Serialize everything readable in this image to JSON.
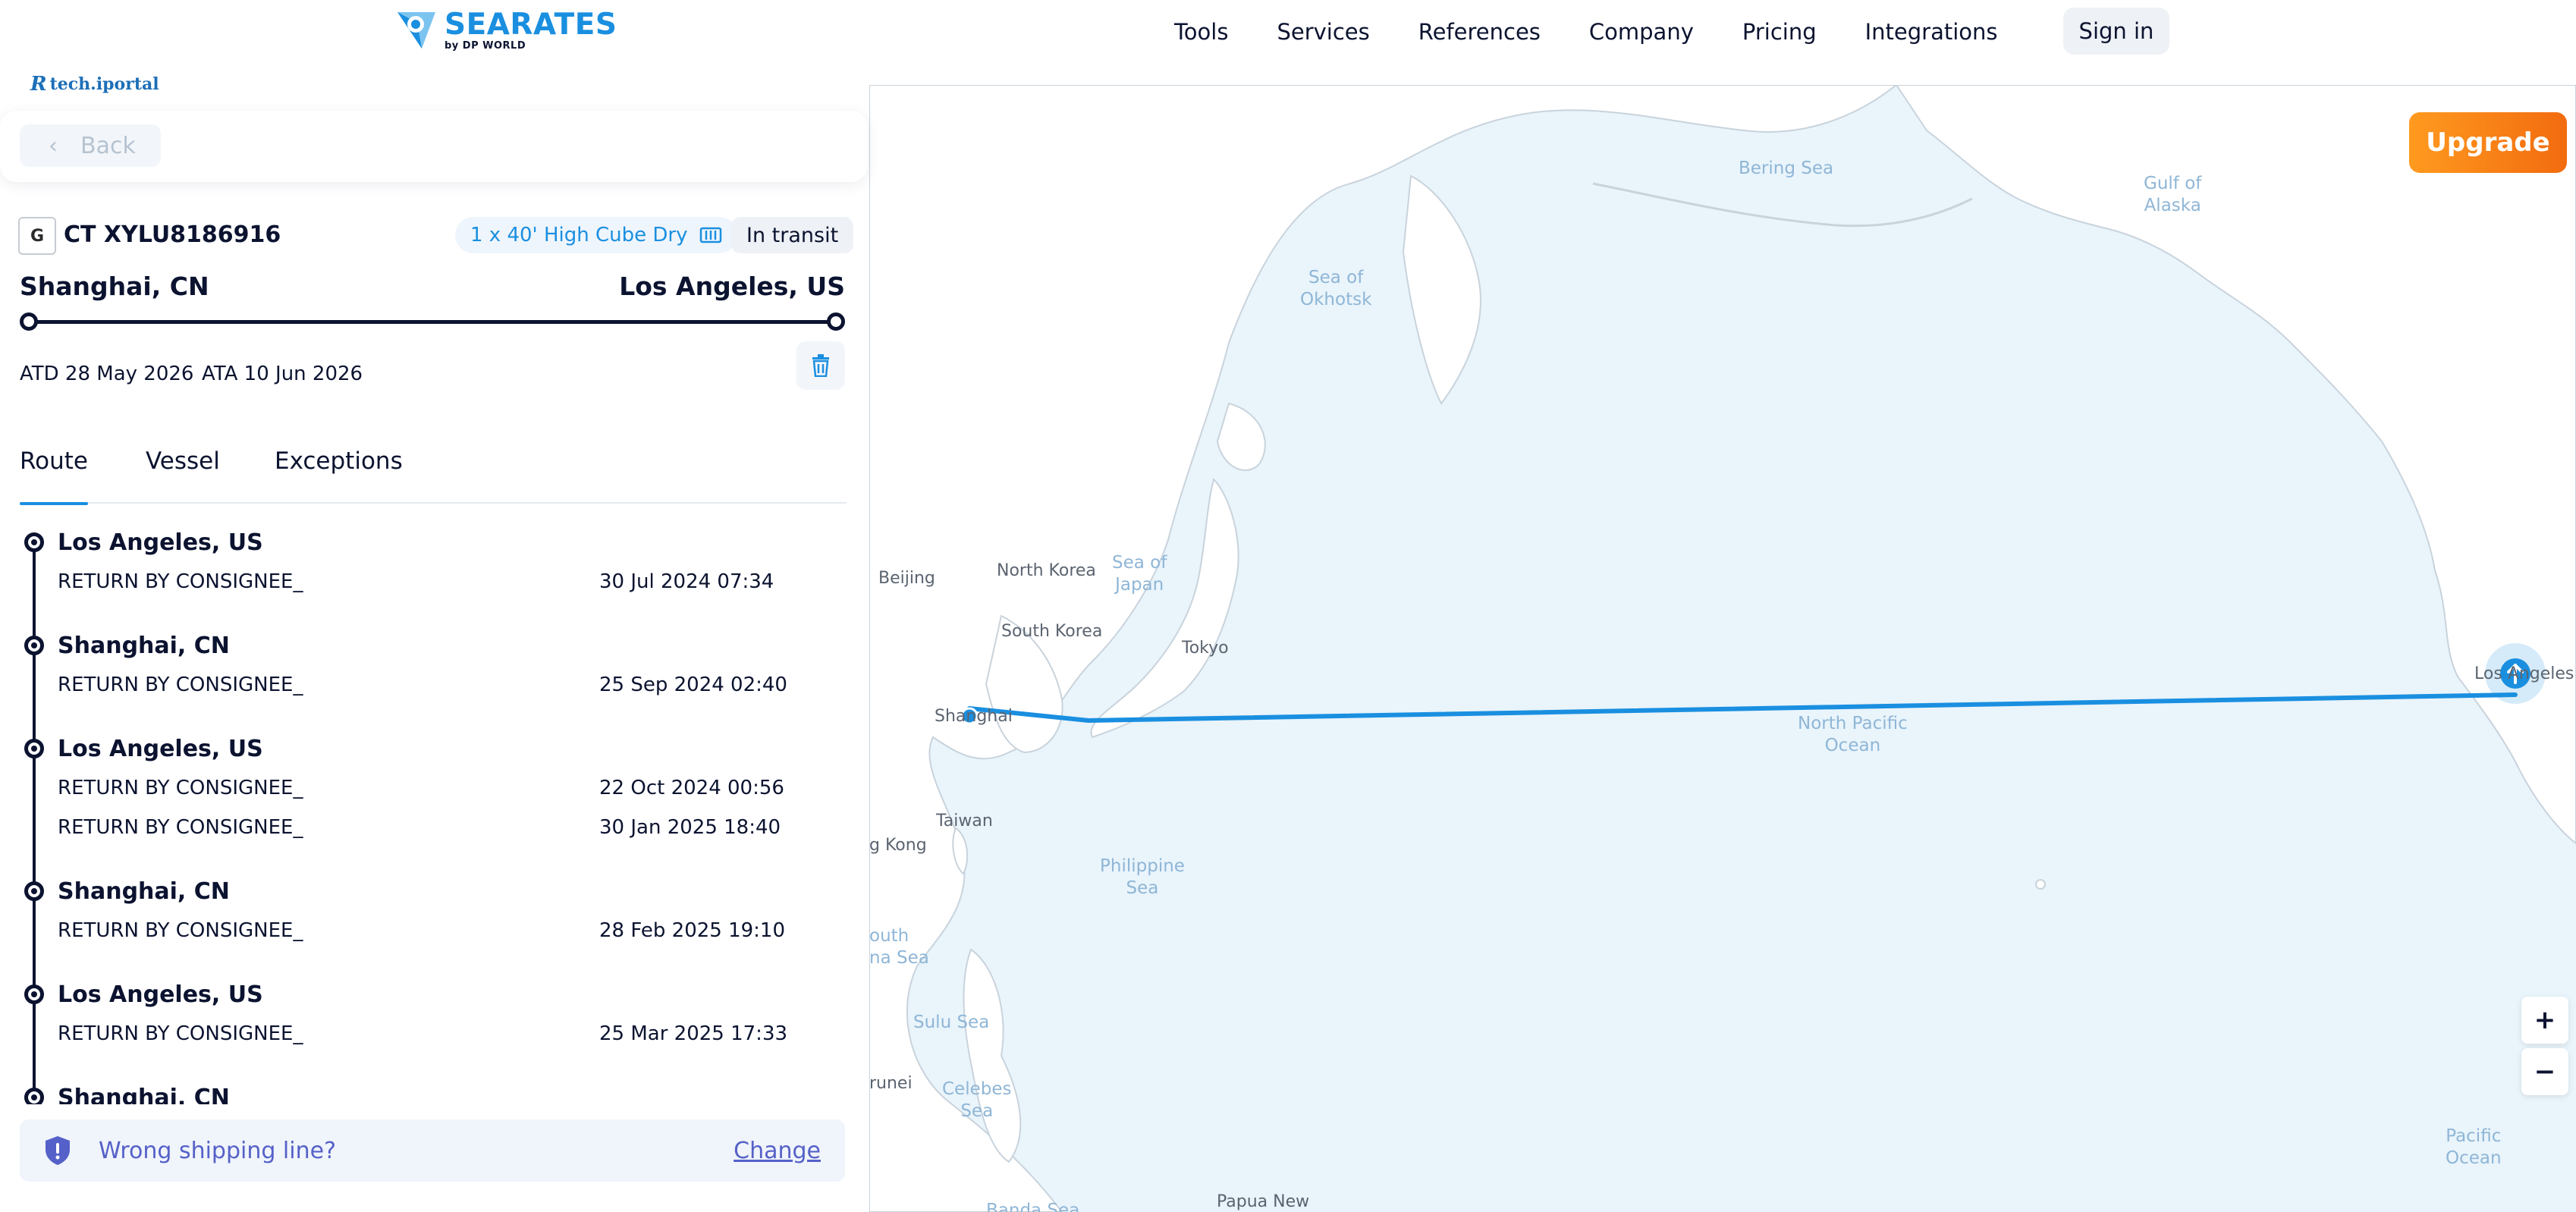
{
  "header": {
    "brand_primary": "SEARATES",
    "brand_secondary": "by DP WORLD",
    "nav": [
      "Tools",
      "Services",
      "References",
      "Company",
      "Pricing",
      "Integrations"
    ],
    "sign_in": "Sign in"
  },
  "watermark": "tech.iportal",
  "back": {
    "label": "Back"
  },
  "shipment": {
    "carrier_logo_text": "G",
    "container_id": "CT XYLU8186916",
    "container_type": "1 x 40' High Cube Dry",
    "status": "In transit",
    "origin": "Shanghai, CN",
    "destination": "Los Angeles, US",
    "atd": "ATD 28 May 2026",
    "ata": "ATA 10 Jun 2026"
  },
  "tabs": [
    "Route",
    "Vessel",
    "Exceptions"
  ],
  "events": [
    {
      "location": "Los Angeles, US",
      "items": [
        {
          "desc": "RETURN BY CONSIGNEE_",
          "time": "30 Jul 2024 07:34"
        }
      ]
    },
    {
      "location": "Shanghai, CN",
      "items": [
        {
          "desc": "RETURN BY CONSIGNEE_",
          "time": "25 Sep 2024 02:40"
        }
      ]
    },
    {
      "location": "Los Angeles, US",
      "items": [
        {
          "desc": "RETURN BY CONSIGNEE_",
          "time": "22 Oct 2024 00:56"
        },
        {
          "desc": "RETURN BY CONSIGNEE_",
          "time": "30 Jan 2025 18:40"
        }
      ]
    },
    {
      "location": "Shanghai, CN",
      "items": [
        {
          "desc": "RETURN BY CONSIGNEE_",
          "time": "28 Feb 2025 19:10"
        }
      ]
    },
    {
      "location": "Los Angeles, US",
      "items": [
        {
          "desc": "RETURN BY CONSIGNEE_",
          "time": "25 Mar 2025 17:33"
        }
      ]
    },
    {
      "location": "Shanghai, CN",
      "items": []
    }
  ],
  "wrong_line": {
    "text": "Wrong shipping line?",
    "action": "Change"
  },
  "map": {
    "upgrade": "Upgrade",
    "zoom_in": "+",
    "zoom_out": "−",
    "places": {
      "beijing": "Beijing",
      "north_korea": "North Korea",
      "south_korea": "South Korea",
      "tokyo": "Tokyo",
      "shanghai": "Shanghai",
      "taiwan": "Taiwan",
      "hong_kong": "g Kong",
      "brunei": "runei",
      "papua": "Papua New",
      "los_angeles": "Los Angeles"
    },
    "seas": {
      "bering": "Bering Sea",
      "okhotsk": "Sea of\nOkhotsk",
      "alaska": "Gulf of\nAlaska",
      "japan": "Sea of\nJapan",
      "north_pacific": "North Pacific\nOcean",
      "philippine": "Philippine\nSea",
      "south_china": "outh\nna Sea",
      "sulu": "Sulu Sea",
      "celebes": "Celebes\nSea",
      "banda": "Banda Sea",
      "pacific": "Pacific\nOcean"
    },
    "colors": {
      "route": "#1a8fe0",
      "water": "#e9f4fb",
      "land": "#ffffff"
    }
  }
}
